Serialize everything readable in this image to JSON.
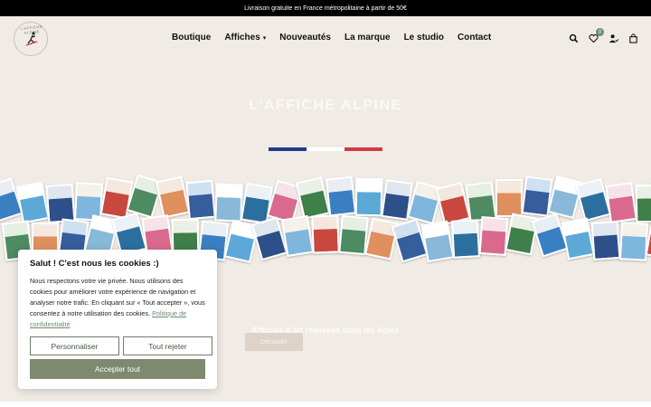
{
  "announcement": "Livraison gratuite en France métropolitaine à partir de 50€",
  "logo": {
    "ring_text": "L'AFFICHE ALPINE"
  },
  "nav": {
    "items": [
      {
        "label": "Boutique"
      },
      {
        "label": "Affiches",
        "has_dropdown": true
      },
      {
        "label": "Nouveautés"
      },
      {
        "label": "La marque"
      },
      {
        "label": "Le studio"
      },
      {
        "label": "Contact"
      }
    ]
  },
  "header_icons": {
    "search": "search-icon",
    "wishlist": "heart-icon",
    "wishlist_count": "0",
    "account": "user-icon",
    "cart": "bag-icon"
  },
  "hero": {
    "title": "L'AFFICHE ALPINE",
    "flag_colors": [
      "#1d3b8f",
      "#ffffff",
      "#d33a3f"
    ],
    "tagline": "Affiches d'art réalisées dans les Alpes",
    "cta": "Découvrir"
  },
  "cookie": {
    "title": "Salut ! C'est nous les cookies :)",
    "text": "Nous respectons votre vie privée. Nous utilisons des cookies pour améliorer votre expérience de navigation  et analyser notre trafic. En cliquant sur « Tout accepter », vous consentez à notre utilisation des cookies.",
    "policy_link": "Politique de confidentialité",
    "customize": "Personnaliser",
    "reject": "Tout rejeter",
    "accept": "Accepter tout"
  },
  "colors": {
    "accent_green": "#7d8a70",
    "hero_bg": "#f1ebe6"
  }
}
